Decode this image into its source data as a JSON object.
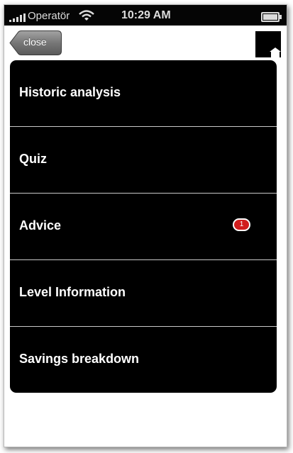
{
  "statusbar": {
    "carrier": "Operatör",
    "time": "10:29 AM"
  },
  "nav": {
    "close_label": "close"
  },
  "menu": {
    "items": [
      {
        "label": "Historic analysis",
        "badge": null
      },
      {
        "label": "Quiz",
        "badge": null
      },
      {
        "label": "Advice",
        "badge": "1"
      },
      {
        "label": "Level Information",
        "badge": null
      },
      {
        "label": "Savings breakdown",
        "badge": null
      }
    ]
  },
  "colors": {
    "menu_background": "#000000",
    "badge": "#d11d1d",
    "close_button": "#6e6e6e"
  }
}
